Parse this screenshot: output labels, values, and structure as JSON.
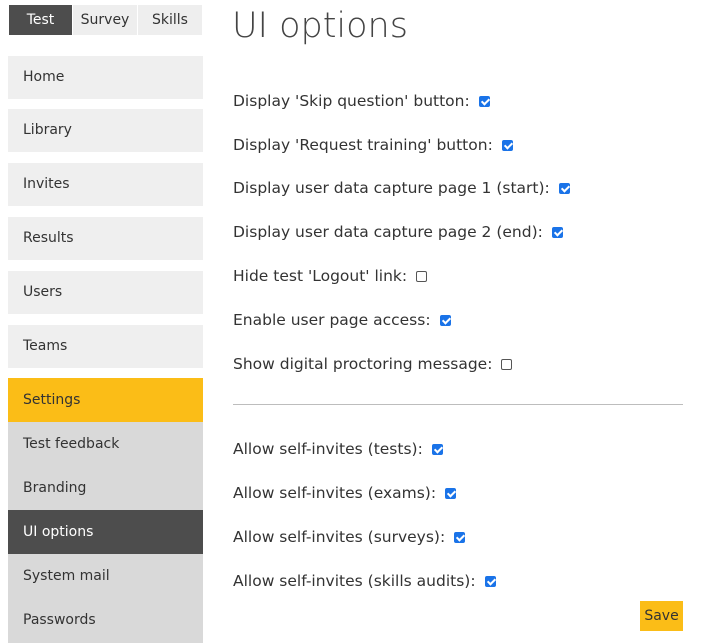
{
  "tabs": [
    "Test",
    "Survey",
    "Skills"
  ],
  "nav": {
    "items": [
      "Home",
      "Library",
      "Invites",
      "Results",
      "Users",
      "Teams",
      "Settings"
    ],
    "sub_items": [
      "Test feedback",
      "Branding",
      "UI options",
      "System mail",
      "Passwords"
    ]
  },
  "page_title": "UI options",
  "options": [
    {
      "label": "Display 'Skip question' button:",
      "checked": true
    },
    {
      "label": "Display 'Request training' button:",
      "checked": true
    },
    {
      "label": "Display user data capture page 1 (start):",
      "checked": true
    },
    {
      "label": "Display user data capture page 2 (end):",
      "checked": true
    },
    {
      "label": "Hide test 'Logout' link:",
      "checked": false
    },
    {
      "label": "Enable user page access:",
      "checked": true
    },
    {
      "label": "Show digital proctoring message:",
      "checked": false
    }
  ],
  "self_invites": [
    {
      "label": "Allow self-invites (tests):",
      "checked": true
    },
    {
      "label": "Allow self-invites (exams):",
      "checked": true
    },
    {
      "label": "Allow self-invites (surveys):",
      "checked": true
    },
    {
      "label": "Allow self-invites (skills audits):",
      "checked": true
    }
  ],
  "save_label": "Save",
  "colors": {
    "accent": "#fbbd17",
    "dark": "#4d4d4d",
    "checkbox": "#1a73e8"
  }
}
